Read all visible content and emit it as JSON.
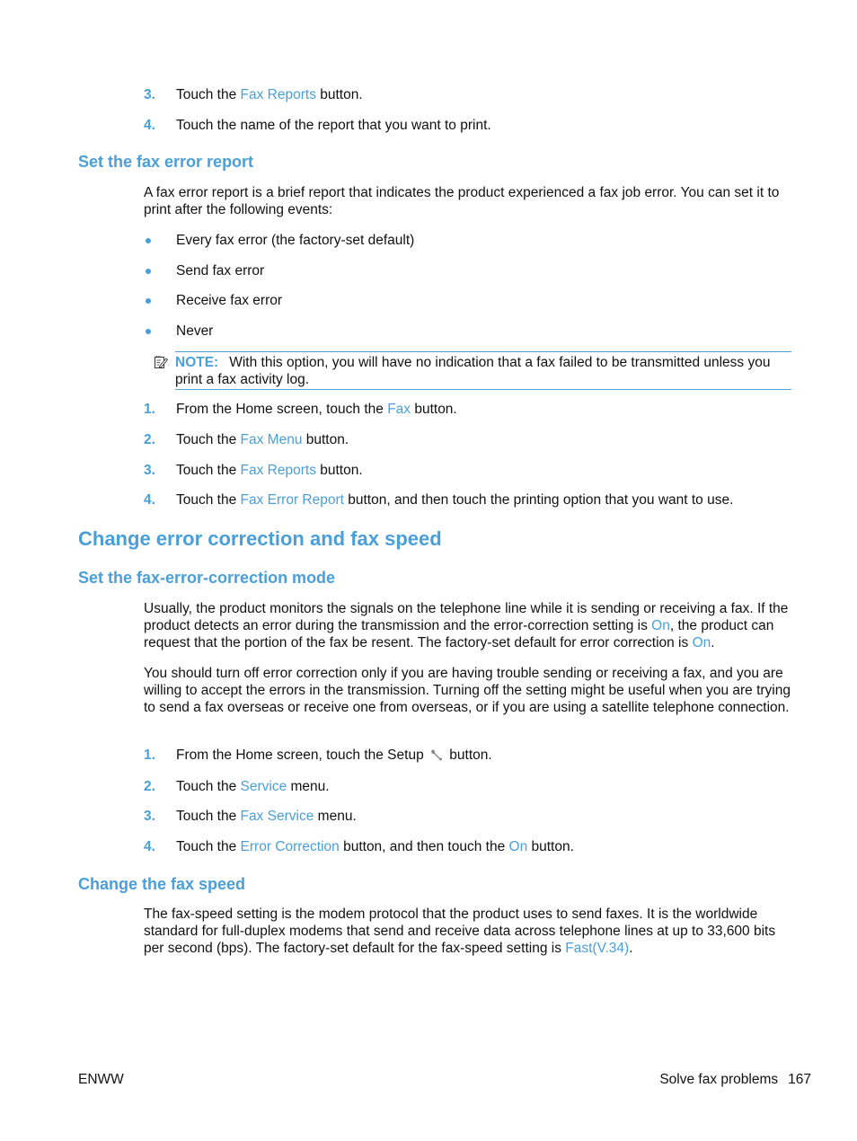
{
  "top_steps": [
    {
      "num": "3.",
      "pre": "Touch the ",
      "link": "Fax Reports",
      "post": " button."
    },
    {
      "num": "4.",
      "pre": "Touch the name of the report that you want to print.",
      "link": "",
      "post": ""
    }
  ],
  "fax_error_report": {
    "heading": "Set the fax error report",
    "intro": "A fax error report is a brief report that indicates the product experienced a fax job error. You can set it to print after the following events:",
    "bullets": [
      "Every fax error (the factory-set default)",
      "Send fax error",
      "Receive fax error",
      "Never"
    ],
    "note": {
      "icon": "note-pencil-icon",
      "label": "NOTE:",
      "text": "With this option, you will have no indication that a fax failed to be transmitted unless you print a fax activity log."
    },
    "steps": [
      {
        "num": "1.",
        "pre": "From the Home screen, touch the ",
        "link": "Fax",
        "post": " button."
      },
      {
        "num": "2.",
        "pre": "Touch the ",
        "link": "Fax Menu",
        "post": " button."
      },
      {
        "num": "3.",
        "pre": "Touch the ",
        "link": "Fax Reports",
        "post": " button."
      },
      {
        "num": "4.",
        "pre": "Touch the ",
        "link": "Fax Error Report",
        "post": " button, and then touch the printing option that you want to use."
      }
    ]
  },
  "change_section": {
    "heading": "Change error correction and fax speed"
  },
  "ecm": {
    "heading": "Set the fax-error-correction mode",
    "para1": {
      "a": "Usually, the product monitors the signals on the telephone line while it is sending or receiving a fax. If the product detects an error during the transmission and the error-correction setting is ",
      "link1": "On",
      "b": ", the product can request that the portion of the fax be resent. The factory-set default for error correction is ",
      "link2": "On",
      "c": "."
    },
    "para2": "You should turn off error correction only if you are having trouble sending or receiving a fax, and you are willing to accept the errors in the transmission. Turning off the setting might be useful when you are trying to send a fax overseas or receive one from overseas, or if you are using a satellite telephone connection.",
    "steps": [
      {
        "num": "1.",
        "pre": "From the Home screen, touch the Setup ",
        "icon": "wrench-icon",
        "post": " button."
      },
      {
        "num": "2.",
        "pre": "Touch the ",
        "link": "Service",
        "post": " menu."
      },
      {
        "num": "3.",
        "pre": "Touch the ",
        "link": "Fax Service",
        "post": " menu."
      },
      {
        "num": "4.",
        "pre": "Touch the ",
        "link": "Error Correction",
        "mid": " button, and then touch the ",
        "link2": "On",
        "post": " button."
      }
    ]
  },
  "fax_speed": {
    "heading": "Change the fax speed",
    "para": "The fax-speed setting is the modem protocol that the product uses to send faxes. It is the worldwide standard for full-duplex modems that send and receive data across telephone lines at up to 33,600 bits per second (bps). The factory-set default for the fax-speed setting is ",
    "link": "Fast(V.34)",
    "end": "."
  },
  "footer": {
    "left": "ENWW",
    "section": "Solve fax problems",
    "page": "167"
  }
}
